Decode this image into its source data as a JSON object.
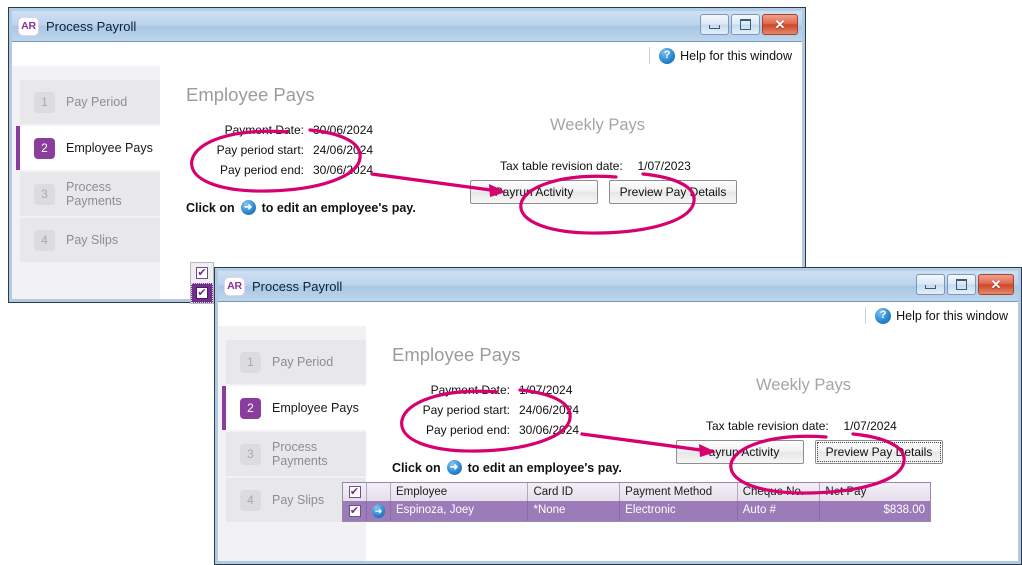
{
  "annotation_color": "#d6006e",
  "accent_purple": "#8b3d9e",
  "windows": [
    {
      "id": "window-top",
      "app_badge": "AR",
      "title": "Process Payroll",
      "help": {
        "label": "Help for this window",
        "icon": "help-question-icon"
      },
      "window_buttons": {
        "minimize": "minimize-icon",
        "maximize": "maximize-icon",
        "close": "close-icon"
      },
      "sidebar": {
        "items": [
          {
            "num": "1",
            "label": "Pay Period",
            "active": false
          },
          {
            "num": "2",
            "label": "Employee Pays",
            "active": true
          },
          {
            "num": "3",
            "label": "Process Payments",
            "active": false
          },
          {
            "num": "4",
            "label": "Pay Slips",
            "active": false
          }
        ]
      },
      "main": {
        "heading": "Employee Pays",
        "subheading": "Weekly Pays",
        "fields": [
          {
            "label": "Payment Date:",
            "value": "30/06/2024"
          },
          {
            "label": "Pay period start:",
            "value": "24/06/2024"
          },
          {
            "label": "Pay period end:",
            "value": "30/06/2024"
          }
        ],
        "tax_label": "Tax table revision date:",
        "tax_value": "1/07/2023",
        "click_prefix": "Click on",
        "click_suffix": "to edit an employee's pay.",
        "buttons": [
          {
            "label": "Payrun Activity",
            "focused": false
          },
          {
            "label": "Preview Pay Details",
            "focused": false
          }
        ]
      }
    },
    {
      "id": "window-bottom",
      "app_badge": "AR",
      "title": "Process Payroll",
      "help": {
        "label": "Help for this window",
        "icon": "help-question-icon"
      },
      "window_buttons": {
        "minimize": "minimize-icon",
        "maximize": "maximize-icon",
        "close": "close-icon"
      },
      "sidebar": {
        "items": [
          {
            "num": "1",
            "label": "Pay Period",
            "active": false
          },
          {
            "num": "2",
            "label": "Employee Pays",
            "active": true
          },
          {
            "num": "3",
            "label": "Process Payments",
            "active": false
          },
          {
            "num": "4",
            "label": "Pay Slips",
            "active": false
          }
        ]
      },
      "main": {
        "heading": "Employee Pays",
        "subheading": "Weekly Pays",
        "fields": [
          {
            "label": "Payment Date:",
            "value": "1/07/2024"
          },
          {
            "label": "Pay period start:",
            "value": "24/06/2024"
          },
          {
            "label": "Pay period end:",
            "value": "30/06/2024"
          }
        ],
        "tax_label": "Tax table revision date:",
        "tax_value": "1/07/2024",
        "click_prefix": "Click on",
        "click_suffix": "to edit an employee's pay.",
        "buttons": [
          {
            "label": "Payrun Activity",
            "focused": false
          },
          {
            "label": "Preview Pay Details",
            "focused": true
          }
        ]
      },
      "table": {
        "columns": [
          "Employee",
          "Card ID",
          "Payment Method",
          "Cheque No.",
          "Net Pay"
        ],
        "header_checkbox_checked": true,
        "rows": [
          {
            "checked": true,
            "row_arrow_icon": "blue-arrow-icon",
            "Employee": "Espinoza, Joey",
            "Card ID": "*None",
            "Payment Method": "Electronic",
            "Cheque No.": "Auto #",
            "Net Pay": "$838.00"
          }
        ]
      }
    }
  ],
  "floating_checkboxes": {
    "header_checked": true,
    "row_checked": true
  }
}
